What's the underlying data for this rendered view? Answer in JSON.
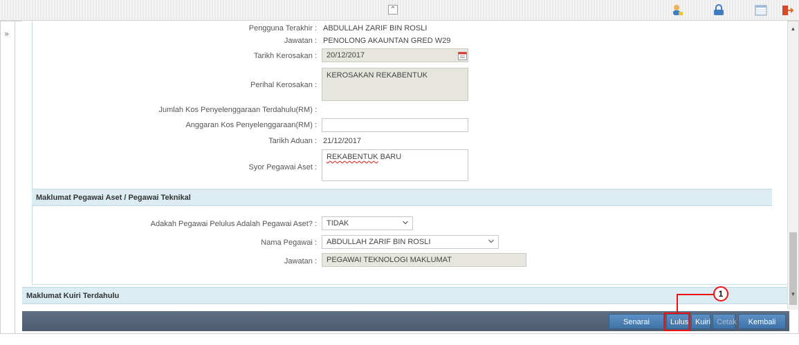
{
  "topbar": {
    "collapse_icon": "double-chevron-up-icon",
    "icons": [
      "user-profile-icon",
      "change-password-icon",
      "calendar-view-icon",
      "logout-icon"
    ]
  },
  "form": {
    "pengguna_terakhir": {
      "label": "Pengguna Terakhir :",
      "value": "ABDULLAH ZARIF BIN ROSLI"
    },
    "jawatan": {
      "label": "Jawatan :",
      "value": "PENOLONG AKAUNTAN GRED W29"
    },
    "tarikh_kerosakan": {
      "label": "Tarikh Kerosakan :",
      "value": "20/12/2017"
    },
    "perihal_kerosakan": {
      "label": "Perihal Kerosakan :",
      "value": "KEROSAKAN REKABENTUK"
    },
    "jumlah_kos": {
      "label": "Jumlah Kos Penyelenggaraan Terdahulu(RM) :",
      "value": ""
    },
    "anggaran_kos": {
      "label": "Anggaran Kos Penyelenggaraan(RM) :",
      "value": ""
    },
    "tarikh_aduan": {
      "label": "Tarikh Aduan :",
      "value": "21/12/2017"
    },
    "syor_pegawai": {
      "label": "Syor Pegawai Aset :",
      "value_part1": "REKABENTUK",
      "value_part2": " BARU"
    }
  },
  "section_pegawai": {
    "title": "Maklumat Pegawai Aset / Pegawai Teknikal",
    "adakah": {
      "label": "Adakah Pegawai Pelulus Adalah Pegawai Aset? :",
      "value": "TIDAK"
    },
    "nama_pegawai": {
      "label": "Nama Pegawai :",
      "value": "ABDULLAH ZARIF BIN ROSLI"
    },
    "jawatan": {
      "label": "Jawatan :",
      "value": "PEGAWAI TEKNOLOGI MAKLUMAT"
    }
  },
  "section_kuiri": {
    "title": "Maklumat Kuiri Terdahulu"
  },
  "footer": {
    "senarai_semak": "Senarai Semak",
    "lulus": "Lulus",
    "kuiri": "Kuiri",
    "cetak": "Cetak",
    "kembali": "Kembali"
  },
  "callout": {
    "number": "1"
  },
  "colors": {
    "accent": "#3f73a8",
    "section_bg": "#dcecf3",
    "highlight": "#ee1111",
    "footer_bg": "#55657a"
  }
}
